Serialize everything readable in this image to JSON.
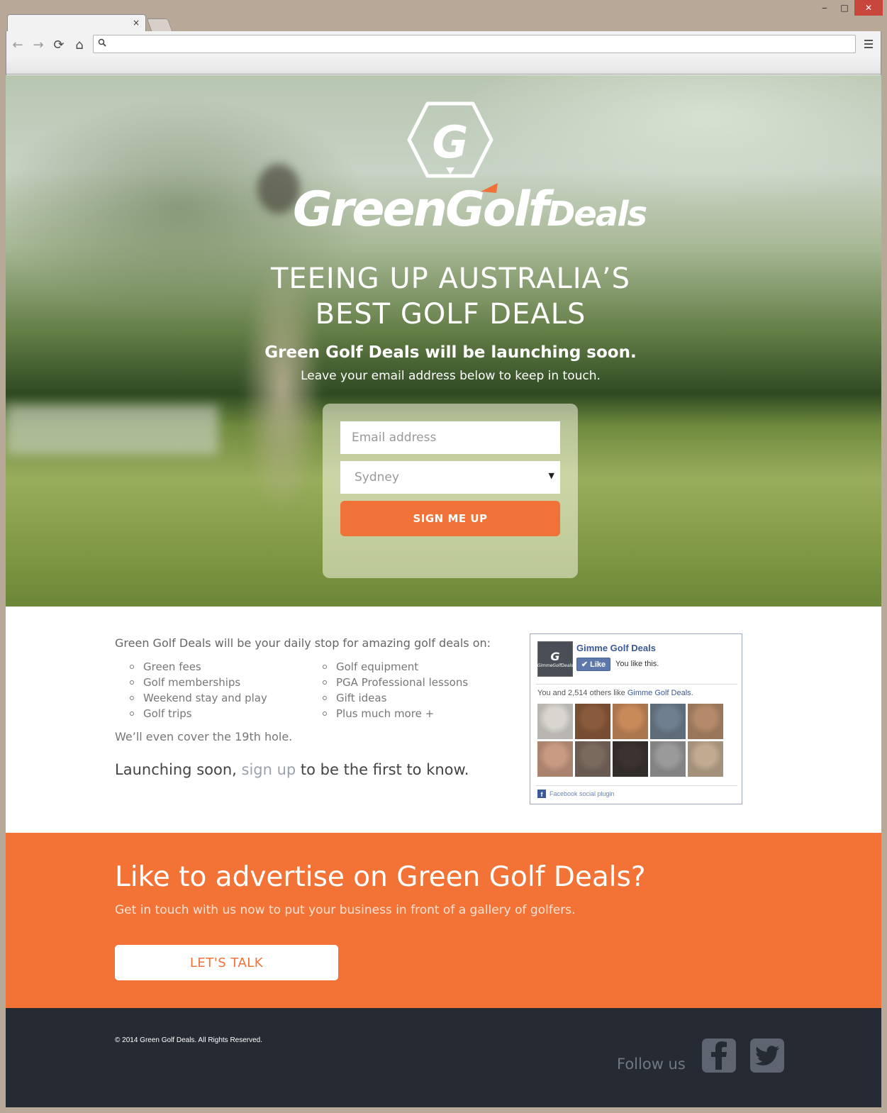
{
  "browser": {
    "tab_close": "×",
    "window_controls": {
      "minimize": "‒",
      "maximize": "□",
      "close": "✕"
    },
    "nav": {
      "back": "←",
      "forward": "→",
      "reload": "⟳",
      "home": "⌂"
    },
    "omnibox": {
      "value": "",
      "icon": "search-icon"
    }
  },
  "hero": {
    "logo": {
      "mark_letter": "G",
      "name_part1": "GreenGolf",
      "name_part2": "Deals"
    },
    "headline_line1": "TEEING UP AUSTRALIA’S",
    "headline_line2": "BEST GOLF DEALS",
    "subhead": "Green Golf Deals will be launching soon.",
    "subhead2": "Leave your email address below to keep in touch.",
    "form": {
      "email_placeholder": "Email address",
      "city_selected": "Sydney",
      "submit_label": "SIGN ME UP"
    }
  },
  "info": {
    "intro": "Green Golf Deals will be your daily stop for amazing golf deals on:",
    "list_left": [
      "Green fees",
      "Golf memberships",
      "Weekend stay and play",
      "Golf trips"
    ],
    "list_right": [
      "Golf equipment",
      "PGA Professional lessons",
      "Gift ideas",
      "Plus much more +"
    ],
    "extra": "We’ll even cover the 19th hole.",
    "launch_prefix": "Launching soon, ",
    "launch_link": "sign up",
    "launch_suffix": " to be the first to know."
  },
  "facebook": {
    "avatar_letter": "G",
    "avatar_text": "GimmeGolfDeals",
    "page_name": "Gimme Golf Deals",
    "like_label": "Like",
    "you_like": "You like this.",
    "count_prefix": "You and 2,514 others like ",
    "count_page": "Gimme Golf Deals.",
    "plugin_label": "Facebook social plugin",
    "faces": [
      "#d9d6d0",
      "#8a5a3c",
      "#c98a5a",
      "#6f7f8f",
      "#b48a6a",
      "#c89a82",
      "#7a6a5e",
      "#3a3330",
      "#9a9a9a",
      "#c0aa90"
    ]
  },
  "advert": {
    "title": "Like to advertise on Green Golf Deals?",
    "subtitle": "Get in touch with us now to put your business in front of a gallery of golfers.",
    "cta_label": "LET'S TALK"
  },
  "footer": {
    "copyright": "© 2014 Green Golf Deals. All Rights Reserved.",
    "follow_label": "Follow us"
  },
  "colors": {
    "accent": "#f37337",
    "footer_bg": "#262a33",
    "facebook_blue": "#3b5998"
  }
}
